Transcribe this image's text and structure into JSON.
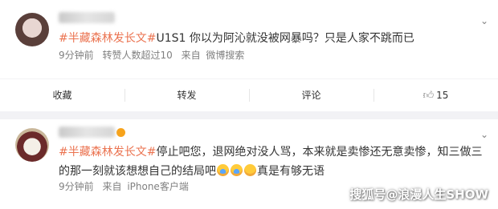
{
  "posts": [
    {
      "topic": "#半藏森林发长文#",
      "body": "U1S1 你以为阿沁就没被网暴吗？只是人家不跳而已",
      "time": "9分钟前",
      "reposts": "转赞人数超过10",
      "source_prefix": "来自",
      "source": "微博搜索"
    },
    {
      "topic": "#半藏森林发长文#",
      "body": "停止吧您，退网绝对没人骂，本来就是卖惨还无意卖惨，知三做三的那一刻就该想想自己的结局吧",
      "body_tail": "真是有够无语",
      "time": "9分钟前",
      "source_prefix": "来自",
      "source": "iPhone客户端"
    }
  ],
  "actions": {
    "collect": "收藏",
    "repost": "转发",
    "comment": "评论",
    "like_count": "15"
  },
  "icons": {
    "more": "chevron-down-icon",
    "like": "thumbs-up-icon"
  },
  "watermark": "搜狐号@浪漫人生SHOW",
  "colors": {
    "topic": "#eb7350",
    "meta": "#808080",
    "background": "#f2f2f5"
  }
}
